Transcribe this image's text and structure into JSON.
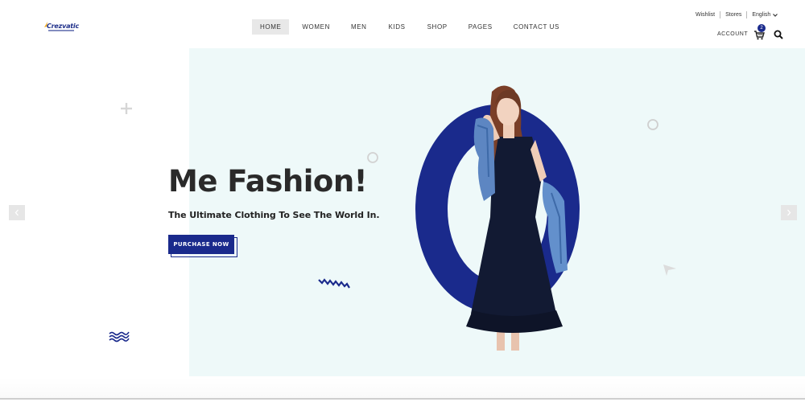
{
  "brand": {
    "logo_text": "Crezvatic"
  },
  "nav": {
    "items": [
      {
        "label": "HOME"
      },
      {
        "label": "WOMEN"
      },
      {
        "label": "MEN"
      },
      {
        "label": "KIDS"
      },
      {
        "label": "SHOP"
      },
      {
        "label": "PAGES"
      },
      {
        "label": "CONTACT US"
      }
    ],
    "active_index": 0
  },
  "top_links": {
    "wishlist": "Wishlist",
    "stores": "Stores",
    "language": "English"
  },
  "account": {
    "label": "ACCOUNT",
    "cart_count": "2"
  },
  "hero": {
    "title": "Me Fashion!",
    "subtitle": "The Ultimate Clothing To See The World In.",
    "cta_label": "PURCHASE NOW"
  },
  "colors": {
    "accent": "#1a2a8c",
    "hero_bg": "#eef9f9",
    "heading": "#2a2a2a"
  },
  "icons": {
    "cart": "cart-icon",
    "search": "search-icon",
    "dropdown": "chevron-down-icon",
    "prev": "chevron-left-icon",
    "next": "chevron-right-icon"
  }
}
